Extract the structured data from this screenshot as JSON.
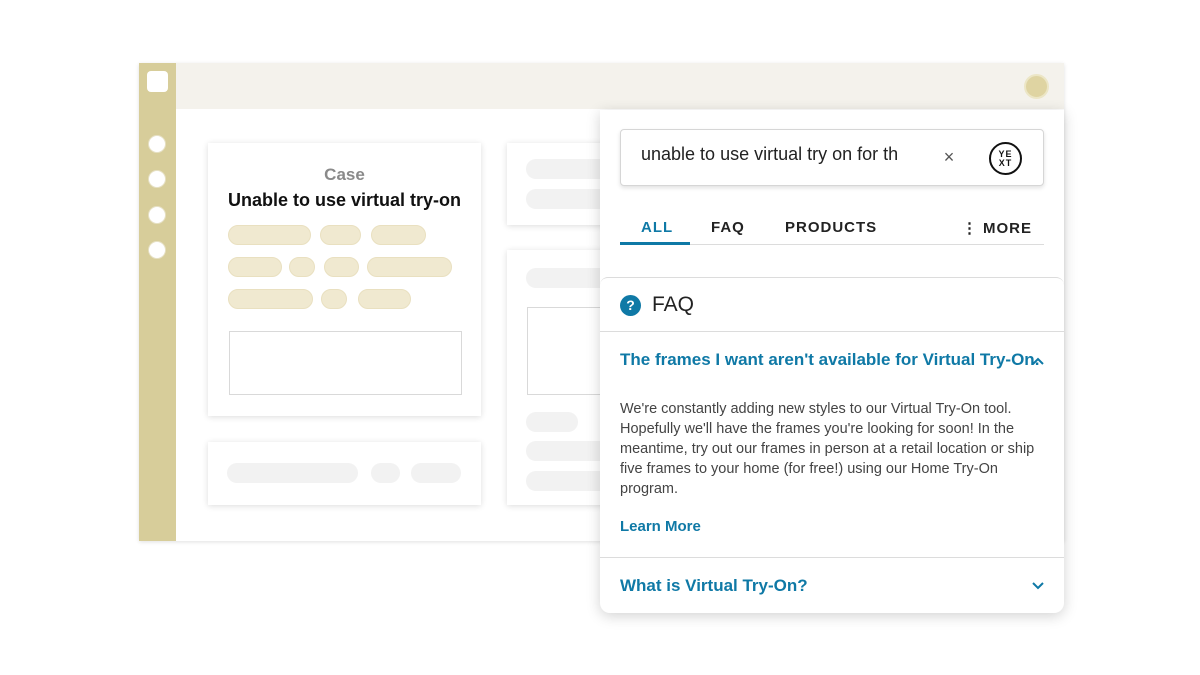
{
  "case_card": {
    "label": "Case",
    "title": "Unable to use virtual try-on"
  },
  "search": {
    "value": "unable to use virtual try on for th",
    "clear_icon": "×",
    "logo_line1": "YE",
    "logo_line2": "XT"
  },
  "tabs": [
    {
      "label": "ALL",
      "active": true
    },
    {
      "label": "FAQ",
      "active": false
    },
    {
      "label": "PRODUCTS",
      "active": false
    }
  ],
  "more_tab": {
    "dots": "⋮",
    "label": "MORE"
  },
  "faq": {
    "icon": "?",
    "title": "FAQ",
    "items": [
      {
        "question": "The frames I want aren't available for Virtual Try-On.",
        "expanded": true,
        "answer": "We're constantly adding new styles to our Virtual Try-On tool. Hopefully we'll have the frames you're looking for soon! In the meantime, try out our frames in person at a retail location or ship five frames to your home (for free!) using our Home Try-On program.",
        "link": "Learn More"
      },
      {
        "question": "What is Virtual Try-On?",
        "expanded": false
      }
    ]
  },
  "colors": {
    "accent": "#0f79a6",
    "sidebar": "#d7cd9a",
    "pill": "#f0e9d0"
  }
}
